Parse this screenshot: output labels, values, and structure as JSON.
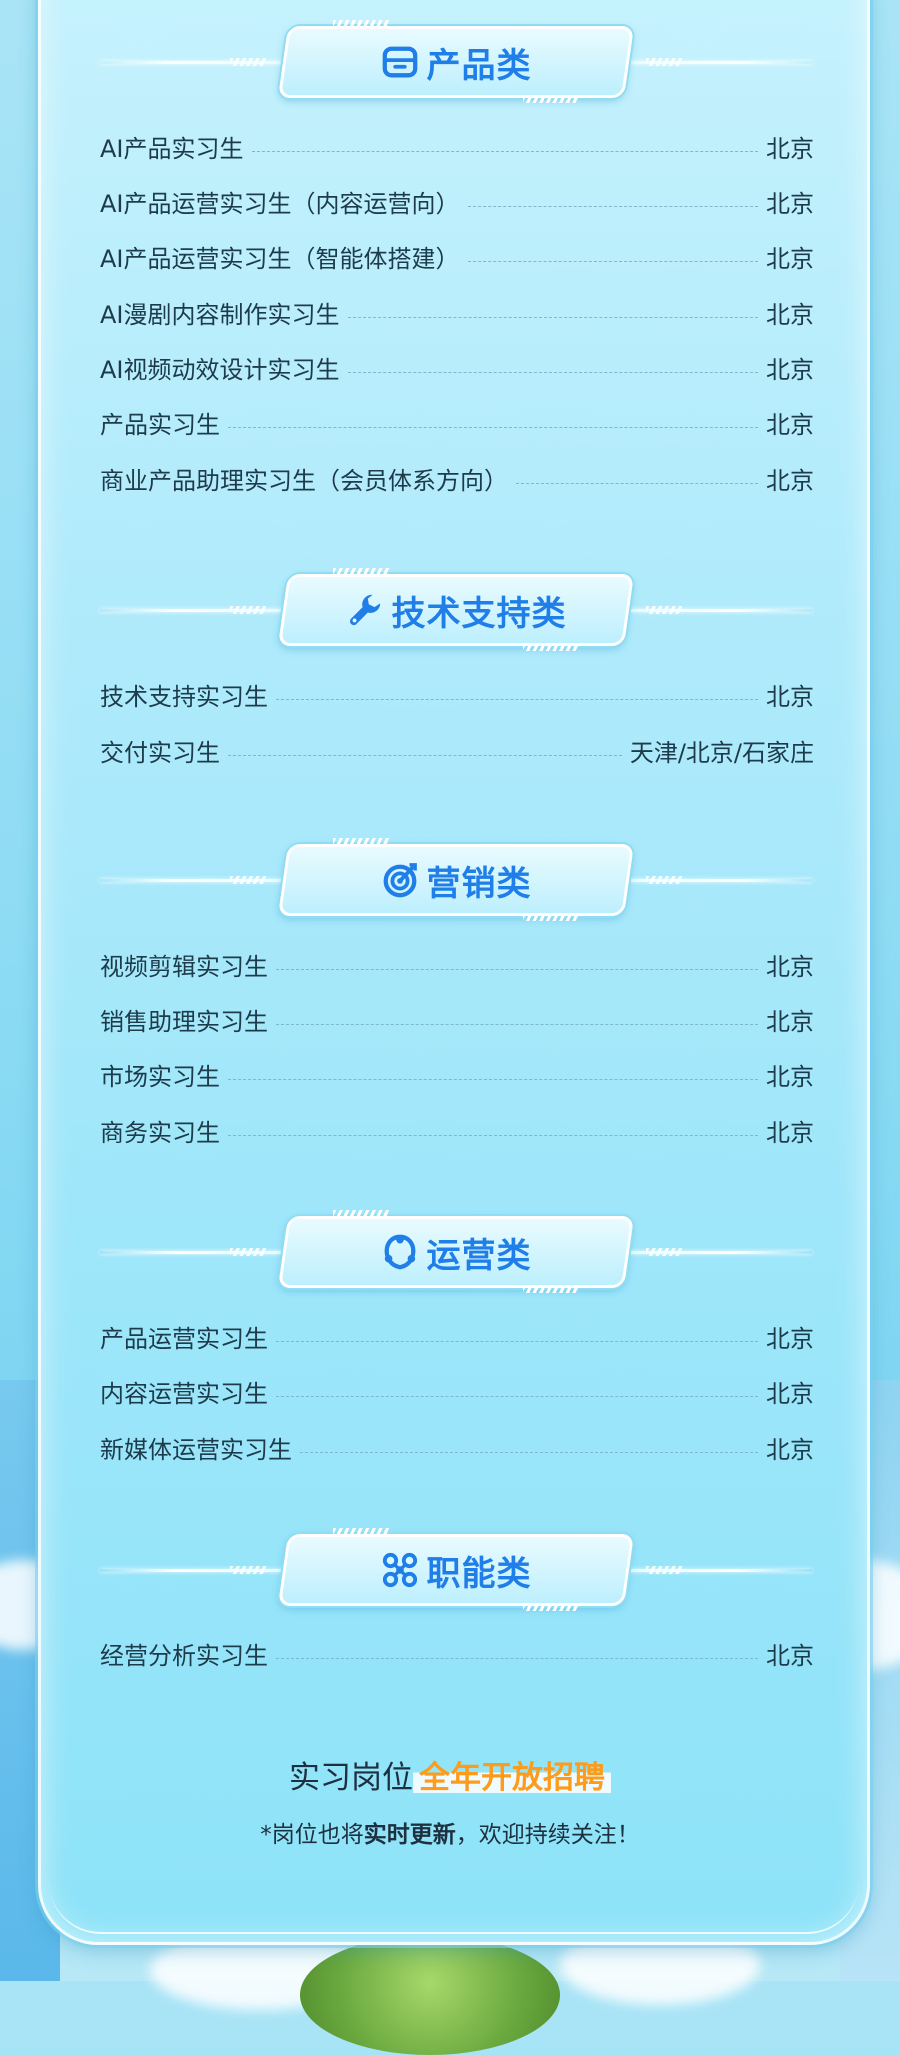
{
  "sections": [
    {
      "title": "产品类",
      "icon": "card-icon",
      "rows": [
        {
          "name": "AI产品实习生",
          "loc": "北京"
        },
        {
          "name": "AI产品运营实习生（内容运营向）",
          "loc": "北京"
        },
        {
          "name": "AI产品运营实习生（智能体搭建）",
          "loc": "北京"
        },
        {
          "name": "AI漫剧内容制作实习生",
          "loc": "北京"
        },
        {
          "name": "AI视频动效设计实习生",
          "loc": "北京"
        },
        {
          "name": "产品实习生",
          "loc": "北京"
        },
        {
          "name": "商业产品助理实习生（会员体系方向）",
          "loc": "北京"
        }
      ]
    },
    {
      "title": "技术支持类",
      "icon": "wrench-icon",
      "rows": [
        {
          "name": "技术支持实习生",
          "loc": "北京"
        },
        {
          "name": "交付实习生",
          "loc": "天津/北京/石家庄"
        }
      ]
    },
    {
      "title": "营销类",
      "icon": "target-icon",
      "rows": [
        {
          "name": "视频剪辑实习生",
          "loc": "北京"
        },
        {
          "name": "销售助理实习生",
          "loc": "北京"
        },
        {
          "name": "市场实习生",
          "loc": "北京"
        },
        {
          "name": "商务实习生",
          "loc": "北京"
        }
      ]
    },
    {
      "title": "运营类",
      "icon": "shield-icon",
      "rows": [
        {
          "name": "产品运营实习生",
          "loc": "北京"
        },
        {
          "name": "内容运营实习生",
          "loc": "北京"
        },
        {
          "name": "新媒体运营实习生",
          "loc": "北京"
        }
      ]
    },
    {
      "title": "职能类",
      "icon": "network-icon",
      "rows": [
        {
          "name": "经营分析实习生",
          "loc": "北京"
        }
      ]
    }
  ],
  "footer": {
    "main_prefix": "实习岗位",
    "main_highlight": "全年开放招聘",
    "sub_prefix": "*岗位也将",
    "sub_bold": "实时更新",
    "sub_suffix": "，欢迎持续关注！"
  },
  "colors": {
    "accent": "#1f7ee8",
    "highlight": "#ff9b1a",
    "text": "#1d3b4a"
  }
}
